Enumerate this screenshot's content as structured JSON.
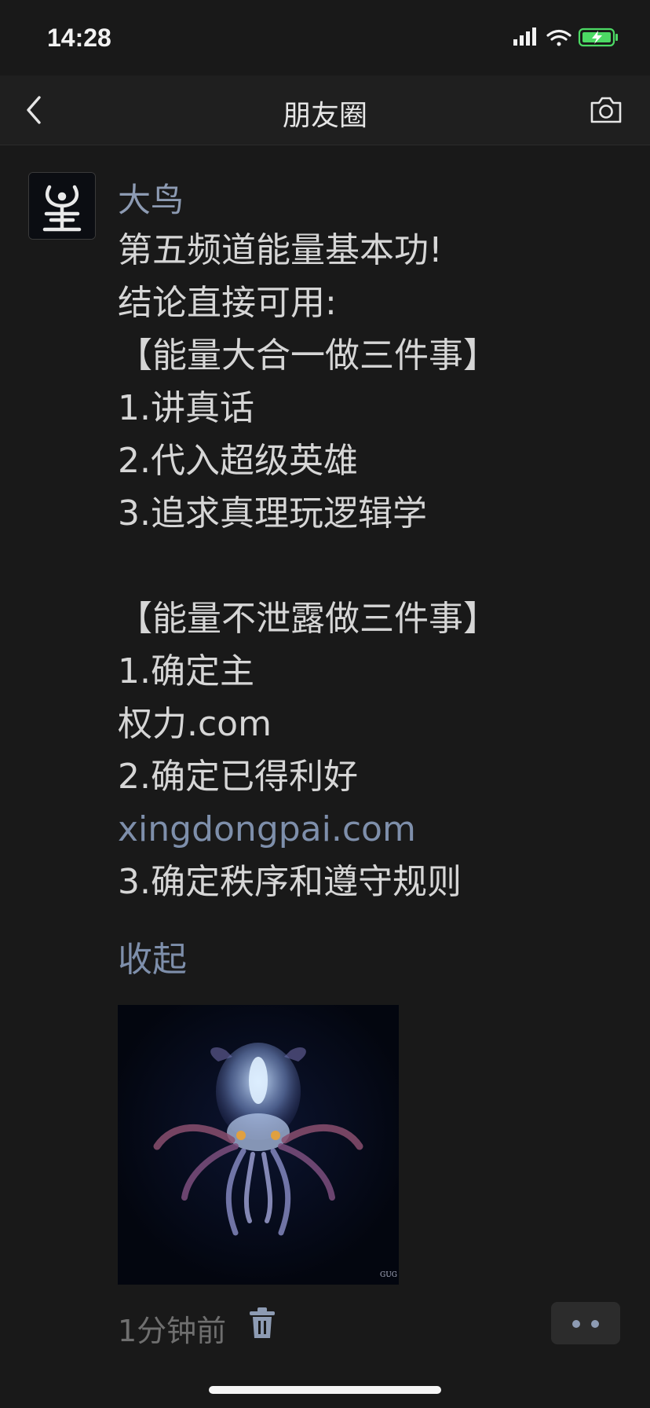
{
  "status_bar": {
    "time": "14:28",
    "icons": [
      "cellular-icon",
      "wifi-icon",
      "battery-charging-icon"
    ],
    "battery_color": "#4cd964"
  },
  "nav": {
    "title": "朋友圈",
    "back_icon": "chevron-left-icon",
    "camera_icon": "camera-icon"
  },
  "post": {
    "author": "大鸟",
    "lines": [
      "第五频道能量基本功!",
      "结论直接可用:",
      "【能量大合一做三件事】",
      "1.讲真话",
      "2.代入超级英雄",
      "3.追求真理玩逻辑学",
      "",
      "【能量不泄露做三件事】",
      "1.确定主",
      "权力.com",
      "2.确定已得利好",
      "xingdongpai.com",
      "3.确定秩序和遵守规则"
    ],
    "collapse_label": "收起",
    "image_watermark": "GUG",
    "time_ago": "1分钟前",
    "link_color": "#7e8fab"
  }
}
